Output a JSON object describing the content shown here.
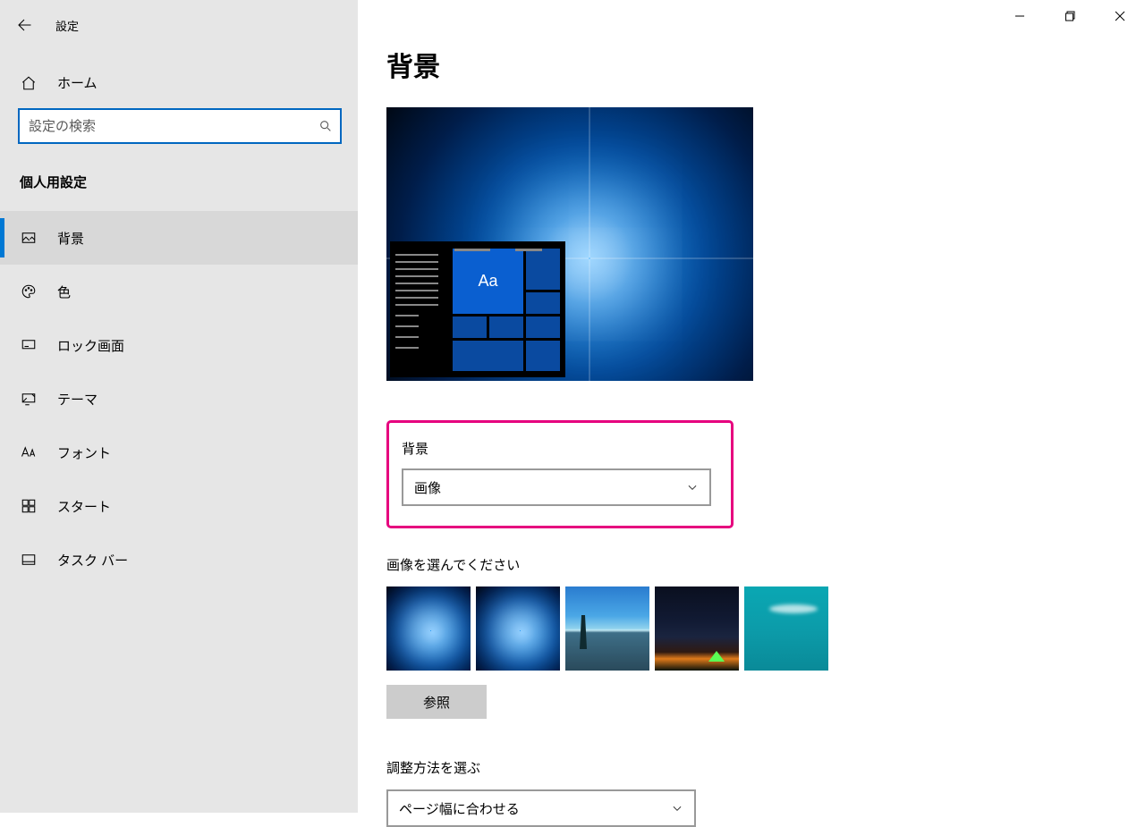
{
  "app": {
    "title": "設定"
  },
  "home": {
    "label": "ホーム"
  },
  "search": {
    "placeholder": "設定の検索"
  },
  "category": {
    "title": "個人用設定"
  },
  "nav": {
    "items": [
      {
        "label": "背景"
      },
      {
        "label": "色"
      },
      {
        "label": "ロック画面"
      },
      {
        "label": "テーマ"
      },
      {
        "label": "フォント"
      },
      {
        "label": "スタート"
      },
      {
        "label": "タスク バー"
      }
    ]
  },
  "page": {
    "title": "背景"
  },
  "preview": {
    "tile_text": "Aa"
  },
  "background_field": {
    "label": "背景",
    "value": "画像"
  },
  "choose_image": {
    "label": "画像を選んでください"
  },
  "browse": {
    "label": "参照"
  },
  "fit": {
    "label": "調整方法を選ぶ",
    "value": "ページ幅に合わせる"
  }
}
